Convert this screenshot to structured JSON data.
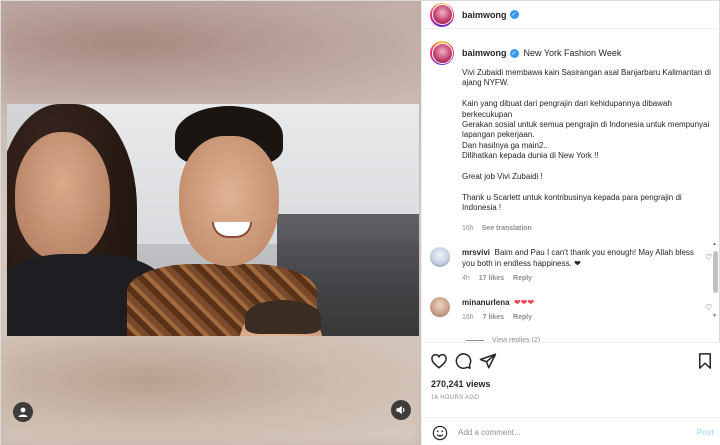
{
  "post": {
    "username": "baimwong",
    "location": "New York Fashion Week",
    "caption": [
      "Vivi Zubaidi membawa kain Sasirangan asal Banjarbaru Kalimantan di ajang NYFW.",
      "Kain yang dibuat dari pengrajin dari kehidupannya dibawah berkecukupan\nGerakan sosial untuk semua pengrajin di Indonesia untuk mempunyai lapangan pekerjaan.\nDan hasilnya ga main2..\nDilihatkan kepada dunia di New York !!",
      "Great job Vivi Zubaidi !",
      "Thank u Scarlett untuk kontribusinya kepada para pengrajin di Indonesia !"
    ],
    "caption_age": "16h",
    "see_translation": "See translation",
    "views": "270,241 views",
    "timestamp": "16 HOURS AGO"
  },
  "comments": [
    {
      "username": "mrsvivi",
      "text": "Baim and Pau I can't thank you enough! May Allah bless you both in endless happiness. ❤",
      "age": "4h",
      "likes": "17 likes",
      "reply": "Reply"
    },
    {
      "username": "minanurlena",
      "text": "❤❤❤",
      "age": "16h",
      "likes": "7 likes",
      "reply": "Reply"
    }
  ],
  "view_replies": "View replies (2)",
  "add_comment": {
    "placeholder": "Add a comment...",
    "post_label": "Post"
  },
  "icons": {
    "like": "heart-icon",
    "comment": "comment-icon",
    "share": "paper-plane-icon",
    "save": "bookmark-icon",
    "emoji": "emoji-icon",
    "user_tag": "user-icon",
    "mute": "speaker-icon",
    "verified": "verified-badge-icon"
  },
  "colors": {
    "verified": "#3897f0",
    "post_disabled": "#b2dffc",
    "heart": "#ed4956",
    "muted_text": "#8e8e8e"
  }
}
